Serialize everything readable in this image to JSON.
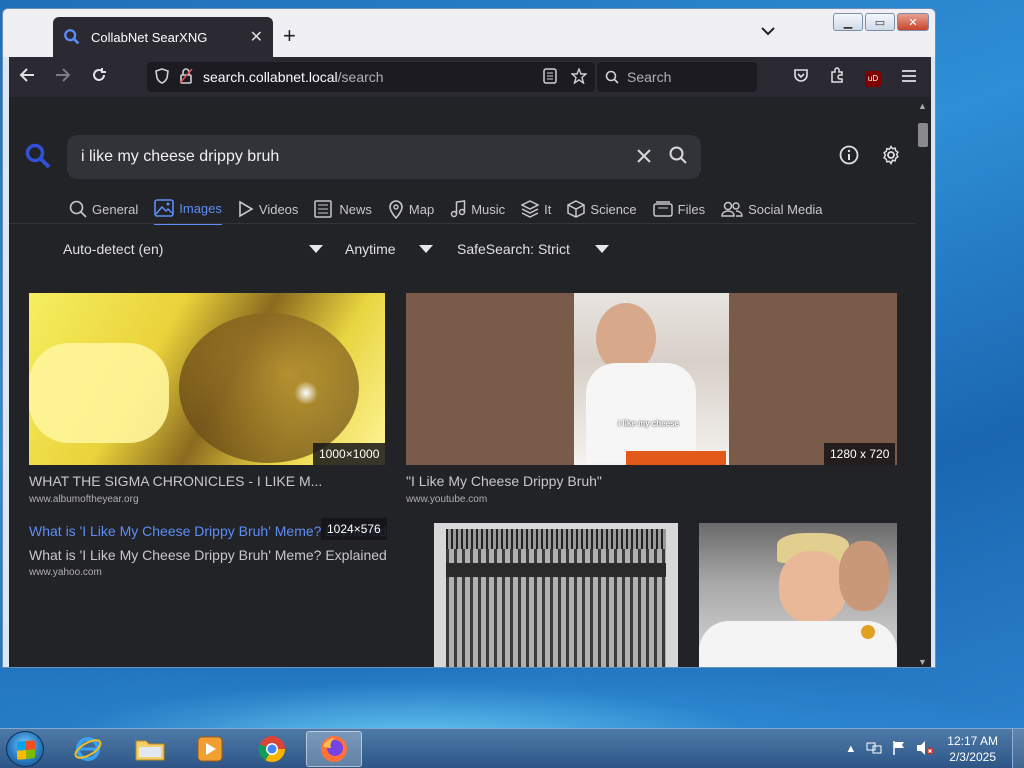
{
  "browser": {
    "tab_title": "CollabNet SearXNG",
    "new_tab": "+",
    "tab_list": "⌄",
    "url_host": "search.collabnet.local",
    "url_path": "/search",
    "search_placeholder": "Search"
  },
  "search": {
    "query": "i like my cheese drippy bruh"
  },
  "categories": [
    {
      "label": "General"
    },
    {
      "label": "Images"
    },
    {
      "label": "Videos"
    },
    {
      "label": "News"
    },
    {
      "label": "Map"
    },
    {
      "label": "Music"
    },
    {
      "label": "It"
    },
    {
      "label": "Science"
    },
    {
      "label": "Files"
    },
    {
      "label": "Social Media"
    }
  ],
  "filters": {
    "language": "Auto-detect (en)",
    "time": "Anytime",
    "safesearch": "SafeSearch: Strict"
  },
  "results": [
    {
      "size": "1000×1000",
      "title": "WHAT THE SIGMA CHRONICLES - I LIKE M...",
      "url": "www.albumoftheyear.org"
    },
    {
      "size": "1280 x 720",
      "title": "\"I Like My Cheese Drippy Bruh\"",
      "url": "www.youtube.com",
      "caption": "i like my cheese"
    },
    {
      "size": "1024×576",
      "title": "What is 'I Like My Cheese Drippy Bruh' Meme? Explained",
      "desc": "What is 'I Like My Cheese Drippy Bruh' Meme? Explained",
      "url": "www.yahoo.com"
    }
  ],
  "taskbar": {
    "time": "12:17 AM",
    "date": "2/3/2025"
  },
  "colors": {
    "accent": "#5e8df5",
    "page_bg": "#222327",
    "toolbar_bg": "#2b2a33"
  }
}
